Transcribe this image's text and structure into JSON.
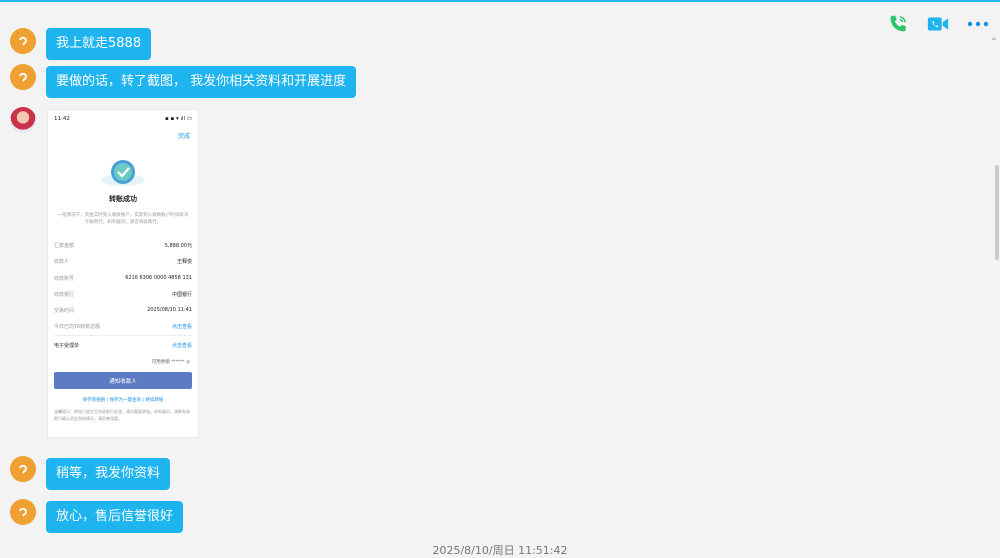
{
  "toolbar": {
    "voice_call_icon": "phone-call-icon",
    "video_call_icon": "video-call-icon",
    "more_icon": "more-icon"
  },
  "messages": [
    {
      "text": "我上就走5888",
      "avatar": "orange"
    },
    {
      "text": "要做的话，转了截图， 我发你相关资料和开展进度",
      "avatar": "orange"
    },
    {
      "text": "稍等，我发你资料",
      "avatar": "orange"
    },
    {
      "text": "放心，售后信誉很好",
      "avatar": "orange"
    }
  ],
  "screenshot": {
    "status_time": "11:42",
    "done": "完成",
    "title": "转账成功",
    "desc": "一般情况下，资金实时到入收款账户，实际到入收款账户时间取决于收款行。如有疑问，请咨询收款行。",
    "rows": [
      {
        "k": "汇款金额",
        "v": "5,888.00元"
      },
      {
        "k": "收款人",
        "v": "王释悦"
      },
      {
        "k": "收款账号",
        "v": "6216 6306 0000 4858 131"
      },
      {
        "k": "收款银行",
        "v": "中国银行"
      },
      {
        "k": "交易时间",
        "v": "2025/08/10 11:41"
      },
      {
        "k": "今日已向TA转账总额",
        "v": "点击查看"
      }
    ],
    "receipt_label": "电子受理单",
    "receipt_link": "点击查看",
    "balance": "可用余额 ****** ◎",
    "notify_button": "通知收款人",
    "links": "保存到相册 | 保存为一键查询 | 继续转账",
    "tip": "温馨提示：转账已提交至所收款行处理，请勿重复转账。如有疑问，请联系收款行确认资金到账情况，请妥善保管。"
  },
  "timestamp": "2025/8/10/周日 11:51:42"
}
